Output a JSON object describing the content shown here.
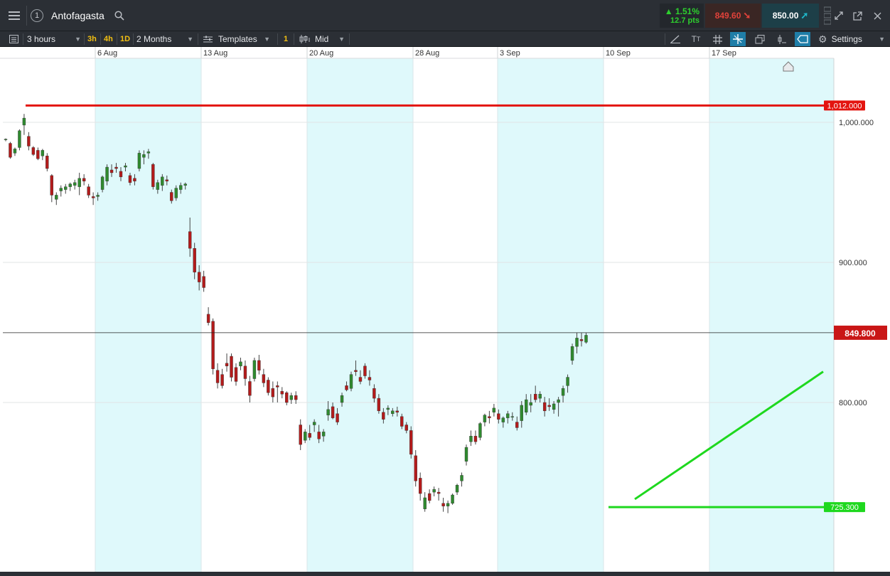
{
  "header": {
    "menu_icon": "hamburger-menu-icon",
    "account_number": "1",
    "instrument": "Antofagasta",
    "search_icon": "search-icon",
    "change_pct": "1.51%",
    "change_pts": "12.7 pts",
    "sell_price": "849.60",
    "buy_price": "850.00",
    "up_color": "#2ed02e",
    "sell_color": "#e0423a",
    "buy_color": "#1fb8c9"
  },
  "toolbar": {
    "list_icon": "list-icon",
    "interval": "3 hours",
    "quick_3h": "3h",
    "quick_4h": "4h",
    "quick_1d": "1D",
    "range": "2 Months",
    "templates_label": "Templates",
    "chart_count": "1",
    "price_type": "Mid",
    "settings_label": "Settings"
  },
  "chart_data": {
    "type": "candlestick",
    "instrument": "Antofagasta",
    "interval": "3 hours",
    "x_ticks": [
      "6 Aug",
      "13 Aug",
      "20 Aug",
      "28 Aug",
      "3 Sep",
      "10 Sep",
      "17 Sep"
    ],
    "y_ticks": [
      "1,000.000",
      "900.000",
      "800.000"
    ],
    "ylim": [
      690,
      1052
    ],
    "current_price_label": "849.800",
    "current_price": 849.8,
    "horizontal_lines": [
      {
        "label": "1,012.000",
        "value": 1012,
        "color": "#e3140f"
      },
      {
        "label": "725.300",
        "value": 725.3,
        "color": "#1ed81e"
      }
    ],
    "trendline": {
      "color": "#1ed81e",
      "from": {
        "date": "11 Sep",
        "price": 731
      },
      "to": {
        "date": "20 Sep",
        "price": 822
      }
    },
    "up_color": "#2f8a2f",
    "down_color": "#b31b1b",
    "shaded_column_color": "#dff9fb",
    "candles": [
      [
        987.5,
        988.5,
        986.5,
        988
      ],
      [
        985,
        986,
        974,
        975
      ],
      [
        978,
        982,
        976,
        981
      ],
      [
        982,
        995,
        980,
        994
      ],
      [
        998,
        1006,
        991,
        1003
      ],
      [
        990,
        993,
        980,
        983
      ],
      [
        982,
        983,
        976,
        977
      ],
      [
        980,
        982,
        973,
        974
      ],
      [
        976,
        981,
        973,
        980
      ],
      [
        976,
        978,
        965,
        967
      ],
      [
        962,
        963,
        943,
        948
      ],
      [
        945,
        950,
        941,
        948
      ],
      [
        951,
        955,
        947,
        953
      ],
      [
        952,
        956,
        949,
        954
      ],
      [
        954,
        957,
        951,
        956
      ],
      [
        955,
        959,
        952,
        957
      ],
      [
        954,
        964,
        948,
        960
      ],
      [
        960,
        963,
        955,
        958
      ],
      [
        954,
        956,
        946,
        948
      ],
      [
        947,
        950,
        941,
        946
      ],
      [
        947,
        950,
        944,
        948
      ],
      [
        952,
        962,
        950,
        961
      ],
      [
        958,
        970,
        955,
        968
      ],
      [
        966,
        970,
        961,
        964
      ],
      [
        968,
        971,
        964,
        967
      ],
      [
        965,
        968,
        958,
        961
      ],
      [
        968,
        971,
        965,
        969
      ],
      [
        962,
        964,
        955,
        957
      ],
      [
        960,
        963,
        955,
        958
      ],
      [
        967,
        980,
        965,
        978
      ],
      [
        975,
        980,
        970,
        977
      ],
      [
        978,
        981,
        974,
        979
      ],
      [
        970,
        971,
        952,
        954
      ],
      [
        952,
        959,
        949,
        957
      ],
      [
        955,
        963,
        951,
        961
      ],
      [
        959,
        962,
        955,
        958
      ],
      [
        950,
        952,
        942,
        944
      ],
      [
        946,
        955,
        944,
        953
      ],
      [
        952,
        957,
        949,
        955
      ],
      [
        955,
        957,
        952,
        956
      ],
      [
        922,
        932,
        904,
        910
      ],
      [
        910,
        914,
        888,
        893
      ],
      [
        893,
        898,
        880,
        886
      ],
      [
        890,
        894,
        879,
        882
      ],
      [
        863,
        868,
        855,
        857
      ],
      [
        858,
        860,
        820,
        824
      ],
      [
        823,
        828,
        810,
        814
      ],
      [
        820,
        824,
        810,
        812
      ],
      [
        828,
        835,
        822,
        826
      ],
      [
        833,
        835,
        815,
        818
      ],
      [
        825,
        828,
        812,
        815
      ],
      [
        826,
        832,
        823,
        829
      ],
      [
        826,
        830,
        812,
        817
      ],
      [
        815,
        819,
        800,
        805
      ],
      [
        817,
        832,
        815,
        830
      ],
      [
        830,
        834,
        820,
        823
      ],
      [
        820,
        824,
        811,
        814
      ],
      [
        816,
        818,
        805,
        807
      ],
      [
        810,
        815,
        800,
        804
      ],
      [
        812,
        815,
        800,
        811
      ],
      [
        808,
        811,
        803,
        806
      ],
      [
        807,
        808,
        798,
        800
      ],
      [
        802,
        807,
        799,
        805
      ],
      [
        805,
        808,
        799,
        802
      ],
      [
        784,
        788,
        766,
        770
      ],
      [
        773,
        781,
        771,
        779
      ],
      [
        778,
        784,
        773,
        775
      ],
      [
        784,
        788,
        779,
        786
      ],
      [
        779,
        784,
        771,
        774
      ],
      [
        776,
        781,
        772,
        779
      ],
      [
        791,
        801,
        787,
        795
      ],
      [
        797,
        800,
        788,
        789
      ],
      [
        792,
        796,
        784,
        786
      ],
      [
        800,
        807,
        797,
        805
      ],
      [
        812,
        815,
        808,
        809
      ],
      [
        810,
        822,
        808,
        820
      ],
      [
        823,
        830,
        819,
        822
      ],
      [
        818,
        823,
        813,
        815
      ],
      [
        826,
        828,
        817,
        819
      ],
      [
        818,
        823,
        812,
        816
      ],
      [
        810,
        813,
        800,
        803
      ],
      [
        803,
        806,
        792,
        794
      ],
      [
        793,
        796,
        785,
        788
      ],
      [
        795,
        798,
        791,
        796
      ],
      [
        792,
        796,
        790,
        794
      ],
      [
        794,
        797,
        790,
        793
      ],
      [
        790,
        792,
        781,
        783
      ],
      [
        784,
        786,
        778,
        780
      ],
      [
        780,
        783,
        760,
        763
      ],
      [
        762,
        766,
        740,
        744
      ],
      [
        746,
        750,
        730,
        735
      ],
      [
        724,
        736,
        722,
        732
      ],
      [
        735,
        738,
        728,
        730
      ],
      [
        736,
        740,
        733,
        738
      ],
      [
        736,
        739,
        730,
        735
      ],
      [
        728,
        732,
        722,
        726
      ],
      [
        726,
        730,
        721,
        728
      ],
      [
        728,
        735,
        727,
        734
      ],
      [
        736,
        742,
        734,
        741
      ],
      [
        744,
        750,
        740,
        748
      ],
      [
        758,
        770,
        755,
        768
      ],
      [
        772,
        780,
        769,
        776
      ],
      [
        776,
        780,
        770,
        772
      ],
      [
        775,
        786,
        773,
        785
      ],
      [
        786,
        792,
        783,
        791
      ],
      [
        790,
        794,
        785,
        789
      ],
      [
        793,
        799,
        790,
        796
      ],
      [
        792,
        795,
        785,
        788
      ],
      [
        786,
        790,
        782,
        789
      ],
      [
        789,
        794,
        785,
        792
      ],
      [
        790,
        793,
        787,
        790
      ],
      [
        786,
        790,
        780,
        782
      ],
      [
        787,
        801,
        782,
        798
      ],
      [
        793,
        806,
        791,
        802
      ],
      [
        798,
        806,
        793,
        800
      ],
      [
        806,
        812,
        800,
        802
      ],
      [
        803,
        808,
        800,
        806
      ],
      [
        800,
        804,
        790,
        794
      ],
      [
        798,
        803,
        794,
        797
      ],
      [
        795,
        801,
        792,
        799
      ],
      [
        800,
        804,
        790,
        802
      ],
      [
        805,
        812,
        800,
        810
      ],
      [
        812,
        820,
        807,
        818
      ],
      [
        830,
        842,
        827,
        840
      ],
      [
        840,
        850,
        835,
        846
      ],
      [
        845,
        850,
        840,
        844
      ],
      [
        843,
        850,
        842,
        848
      ]
    ]
  }
}
